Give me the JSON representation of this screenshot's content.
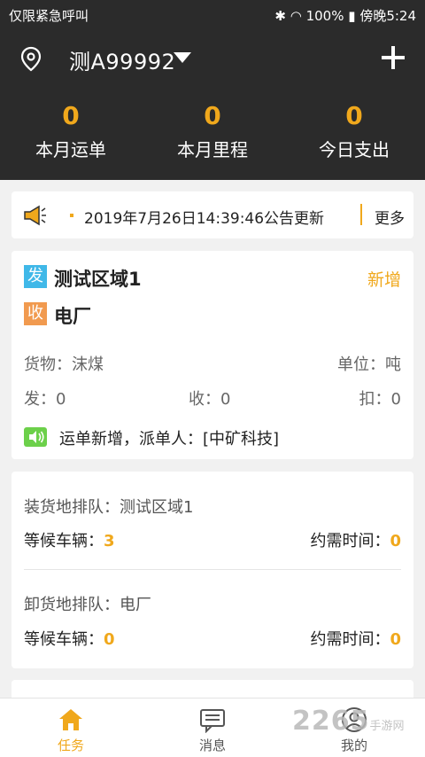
{
  "status_bar": {
    "left_text": "仅限紧急呼叫",
    "battery": "100%",
    "time": "傍晚5:24"
  },
  "header": {
    "plate": "测A99992",
    "stats": [
      {
        "value": "0",
        "label": "本月运单"
      },
      {
        "value": "0",
        "label": "本月里程"
      },
      {
        "value": "0",
        "label": "今日支出"
      }
    ]
  },
  "notice": {
    "text": "2019年7月26日14:39:46公告更新",
    "more": "更多"
  },
  "order": {
    "from_badge": "发",
    "from": "测试区域1",
    "to_badge": "收",
    "to": "电厂",
    "status": "新增",
    "cargo": "货物：沫煤",
    "unit": "单位：吨",
    "send": "发：0",
    "receive": "收：0",
    "deduct": "扣：0",
    "message": "运单新增，派单人：[中矿科技]"
  },
  "queue": {
    "load_title": "装货地排队：测试区域1",
    "load_wait_label": "等候车辆：",
    "load_wait_value": "3",
    "load_time_label": "约需时间：",
    "load_time_value": "0",
    "unload_title": "卸货地排队：电厂",
    "unload_wait_label": "等候车辆：",
    "unload_wait_value": "0",
    "unload_time_label": "约需时间：",
    "unload_time_value": "0"
  },
  "tabs": [
    {
      "label": "任务",
      "icon": "home-icon",
      "active": true
    },
    {
      "label": "消息",
      "icon": "message-icon",
      "active": false
    },
    {
      "label": "我的",
      "icon": "user-icon",
      "active": false
    }
  ],
  "watermark": {
    "text": "2265",
    "sub": "手游网"
  },
  "colors": {
    "accent": "#f0a81c",
    "header_bg": "#2b2b2b",
    "from_badge": "#40b8e8",
    "to_badge": "#f19a4f",
    "voice": "#6cd04a"
  }
}
